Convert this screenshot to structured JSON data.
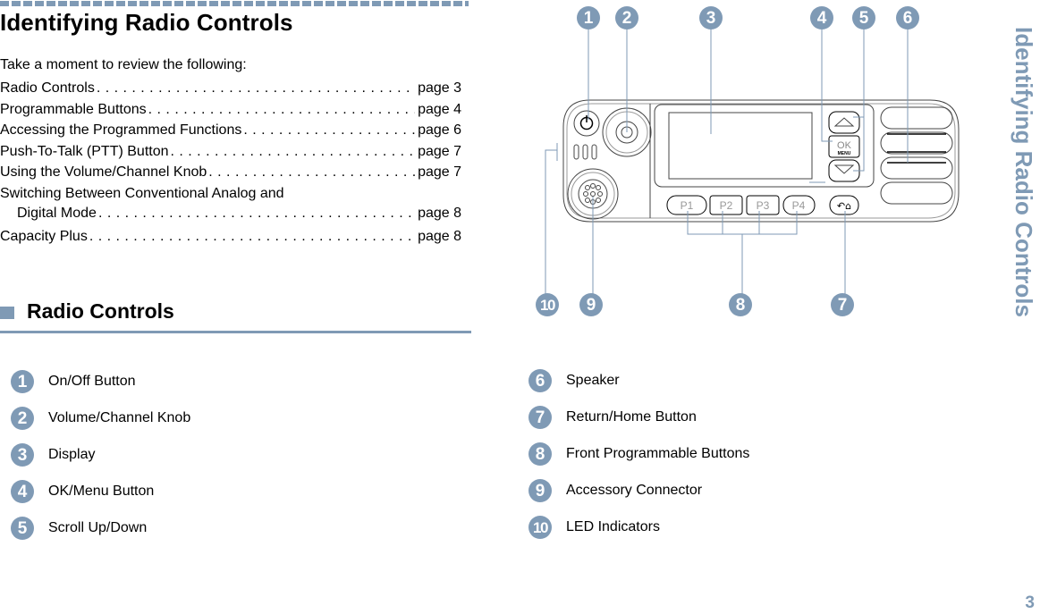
{
  "header": {
    "title": "Identifying Radio Controls",
    "intro": "Take a moment to review the following:"
  },
  "toc": [
    {
      "label": "Radio Controls",
      "page": "page 3"
    },
    {
      "label": "Programmable Buttons ",
      "page": "page 4"
    },
    {
      "label": "Accessing the Programmed Functions ",
      "page": "page 6"
    },
    {
      "label": "Push-To-Talk (PTT) Button ",
      "page": "page 7"
    },
    {
      "label": "Using the Volume/Channel Knob",
      "page": "page 7"
    },
    {
      "label": "Switching Between Conventional Analog and",
      "label2": "Digital Mode",
      "page": "page 8"
    },
    {
      "label": "Capacity Plus",
      "page": "page 8"
    }
  ],
  "section": {
    "title": "Radio Controls"
  },
  "controls": [
    {
      "num": "1",
      "label": "On/Off Button"
    },
    {
      "num": "2",
      "label": "Volume/Channel Knob"
    },
    {
      "num": "3",
      "label": "Display"
    },
    {
      "num": "4",
      "label": "OK/Menu Button"
    },
    {
      "num": "5",
      "label": "Scroll Up/Down"
    },
    {
      "num": "6",
      "label": "Speaker"
    },
    {
      "num": "7",
      "label": "Return/Home Button"
    },
    {
      "num": "8",
      "label": "Front Programmable Buttons"
    },
    {
      "num": "9",
      "label": "Accessory Connector"
    },
    {
      "num": "10",
      "label": "LED Indicators"
    }
  ],
  "diagram": {
    "ok_label": "OK",
    "menu_label": "MENU",
    "prog_buttons": [
      "P1",
      "P2",
      "P3",
      "P4"
    ],
    "icons": {
      "power": "power-icon",
      "return_home": "return-home-icon",
      "scroll_up": "triangle-up-icon",
      "scroll_down": "triangle-down-icon"
    }
  },
  "sidebar": {
    "title": "Identifying Radio Controls"
  },
  "footer": {
    "page_number": "3"
  },
  "colors": {
    "accent": "#7f9ab5",
    "text": "#000000",
    "line_art": "#333333"
  }
}
